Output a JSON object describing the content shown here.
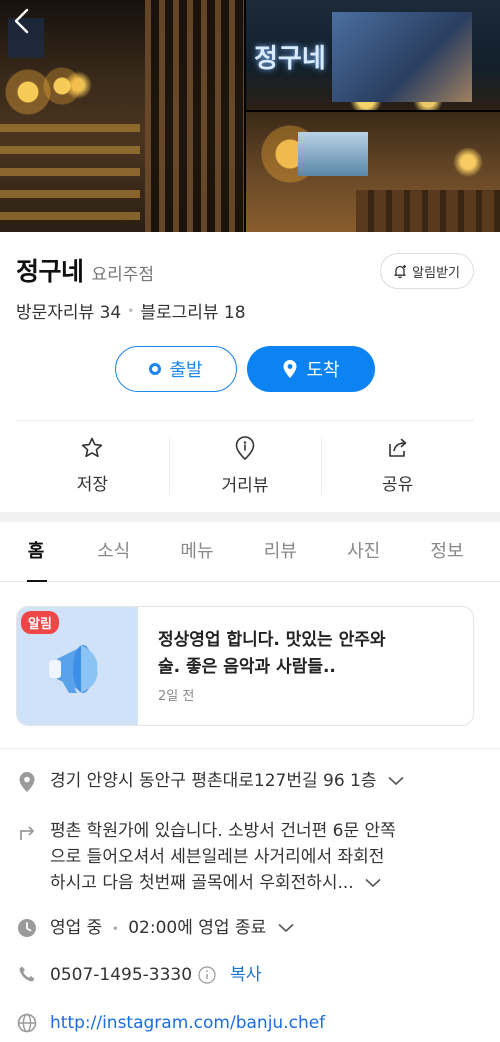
{
  "place": {
    "name": "정구네",
    "category": "요리주점",
    "alarm_label": "알림받기",
    "visitor_reviews": "방문자리뷰 34",
    "blog_reviews": "블로그리뷰 18"
  },
  "route": {
    "start_label": "출발",
    "arrive_label": "도착"
  },
  "photo_sign_text": "정구네",
  "actions": [
    {
      "label": "저장",
      "icon": "star-icon"
    },
    {
      "label": "거리뷰",
      "icon": "pin-outline-icon"
    },
    {
      "label": "공유",
      "icon": "share-icon"
    }
  ],
  "tabs": [
    "홈",
    "소식",
    "메뉴",
    "리뷰",
    "사진",
    "정보"
  ],
  "active_tab": "홈",
  "notice": {
    "badge": "알림",
    "title_line1": "정상영업 합니다. 맛있는 안주와",
    "title_line2": "술. 좋은 음악과 사람들..",
    "time": "2일 전"
  },
  "info": {
    "address": "경기 안양시 동안구 평촌대로127번길 96 1층",
    "directions_line1": "평촌 학원가에 있습니다. 소방서 건너편 6문 안쪽",
    "directions_line2": "으로 들어오셔서 세븐일레븐 사거리에서 좌회전",
    "directions_line3": "하시고 다음 첫번째 골목에서 우회전하시...",
    "hours_status": "영업 중",
    "hours_detail": "02:00에 영업 종료",
    "phone": "0507-1495-3330",
    "copy_label": "복사",
    "website": "http://instagram.com/banju.chef"
  },
  "colors": {
    "accent": "#0b83f3",
    "badge": "#f14646",
    "notice_bg": "#cfe2f7",
    "link": "#1a6ee0"
  }
}
